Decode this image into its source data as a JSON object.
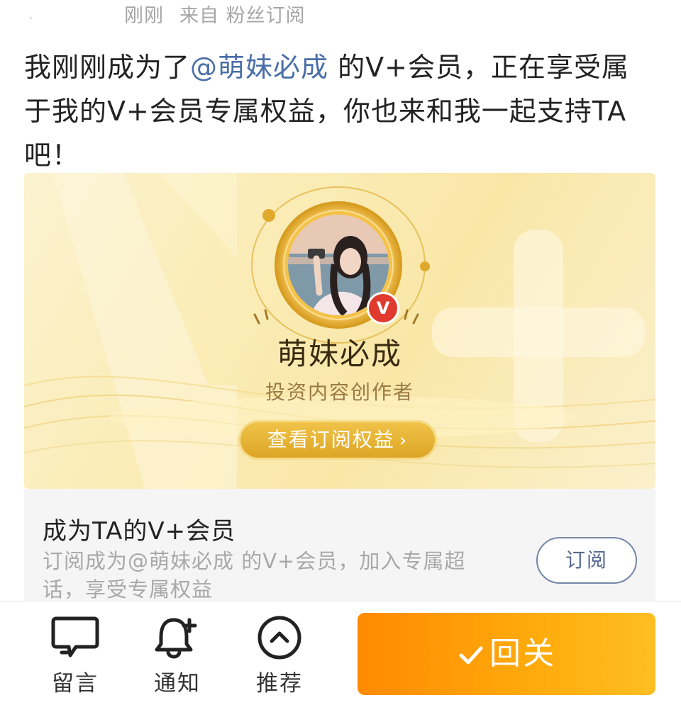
{
  "meta": {
    "time": "刚刚",
    "source": "来自 粉丝订阅"
  },
  "post": {
    "text_before": "我刚刚成为了",
    "mention": "@萌妹必成",
    "text_after": " 的V+会员，正在享受属于我的V+会员专属权益，你也来和我一起支持TA吧！"
  },
  "card": {
    "creator_name": "萌妹必成",
    "creator_role": "投资内容创作者",
    "benefits_button": "查看订阅权益",
    "badge": "V",
    "chevron": "›"
  },
  "subscribe": {
    "title": "成为TA的V+会员",
    "description": "订阅成为@萌妹必成 的V+会员，加入专属超话，享受专属权益",
    "button": "订阅"
  },
  "toolbar": {
    "comment_label": "留言",
    "notify_label": "通知",
    "recommend_label": "推荐",
    "reply_label": "回关"
  },
  "icons": {
    "comment": "comment-icon",
    "notify": "bell-plus-icon",
    "recommend": "chevron-up-circle-icon",
    "check": "check-icon"
  },
  "colors": {
    "accent_orange": "#ff8a00",
    "mention_blue": "#4a6ea8",
    "gold": "#dca323",
    "badge_red": "#e03a2e"
  }
}
